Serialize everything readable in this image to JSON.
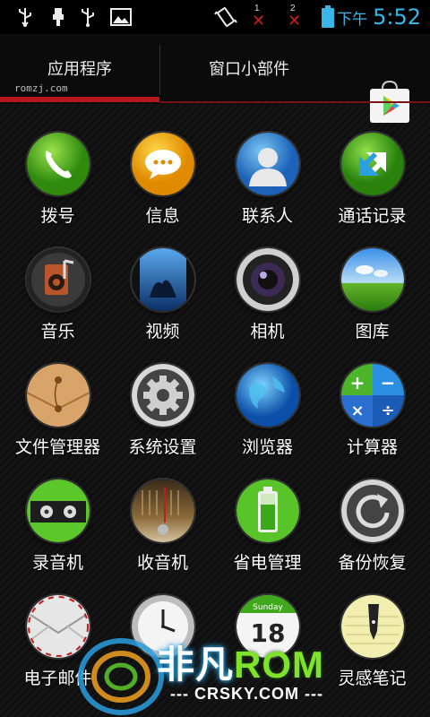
{
  "status_bar": {
    "icons": [
      "usb-icon",
      "usb-debug-icon",
      "usb-icon",
      "image-icon",
      "vibrate-icon",
      "no-signal-sim1-icon",
      "no-signal-sim2-icon",
      "battery-icon"
    ],
    "sim1_label": "1",
    "sim2_label": "2",
    "ampm": "下午",
    "time": "5:52",
    "clock_color": "#39b6e8"
  },
  "tabs": {
    "apps_label": "应用程序",
    "widgets_label": "窗口小部件",
    "watermark": "romzj.com",
    "active_color": "#b5181c"
  },
  "apps": [
    {
      "label": "拨号",
      "icon": "phone-icon"
    },
    {
      "label": "信息",
      "icon": "messaging-icon"
    },
    {
      "label": "联系人",
      "icon": "contacts-icon"
    },
    {
      "label": "通话记录",
      "icon": "call-log-icon"
    },
    {
      "label": "音乐",
      "icon": "music-icon"
    },
    {
      "label": "视频",
      "icon": "video-icon"
    },
    {
      "label": "相机",
      "icon": "camera-icon"
    },
    {
      "label": "图库",
      "icon": "gallery-icon"
    },
    {
      "label": "文件管理器",
      "icon": "file-manager-icon"
    },
    {
      "label": "系统设置",
      "icon": "settings-icon"
    },
    {
      "label": "浏览器",
      "icon": "browser-icon"
    },
    {
      "label": "计算器",
      "icon": "calculator-icon"
    },
    {
      "label": "录音机",
      "icon": "recorder-icon"
    },
    {
      "label": "收音机",
      "icon": "radio-icon"
    },
    {
      "label": "省电管理",
      "icon": "battery-manager-icon"
    },
    {
      "label": "备份恢复",
      "icon": "backup-icon"
    },
    {
      "label": "电子邮件",
      "icon": "email-icon"
    },
    {
      "label": "",
      "icon": "clock-icon"
    },
    {
      "label": "",
      "icon": "calendar-icon",
      "day_name": "Sunday",
      "day_number": "18"
    },
    {
      "label": "灵感笔记",
      "icon": "notes-icon"
    }
  ],
  "watermark_brand": {
    "title_cn": "非凡",
    "title_rom": "ROM",
    "url": "--- CRSKY.COM ---"
  }
}
